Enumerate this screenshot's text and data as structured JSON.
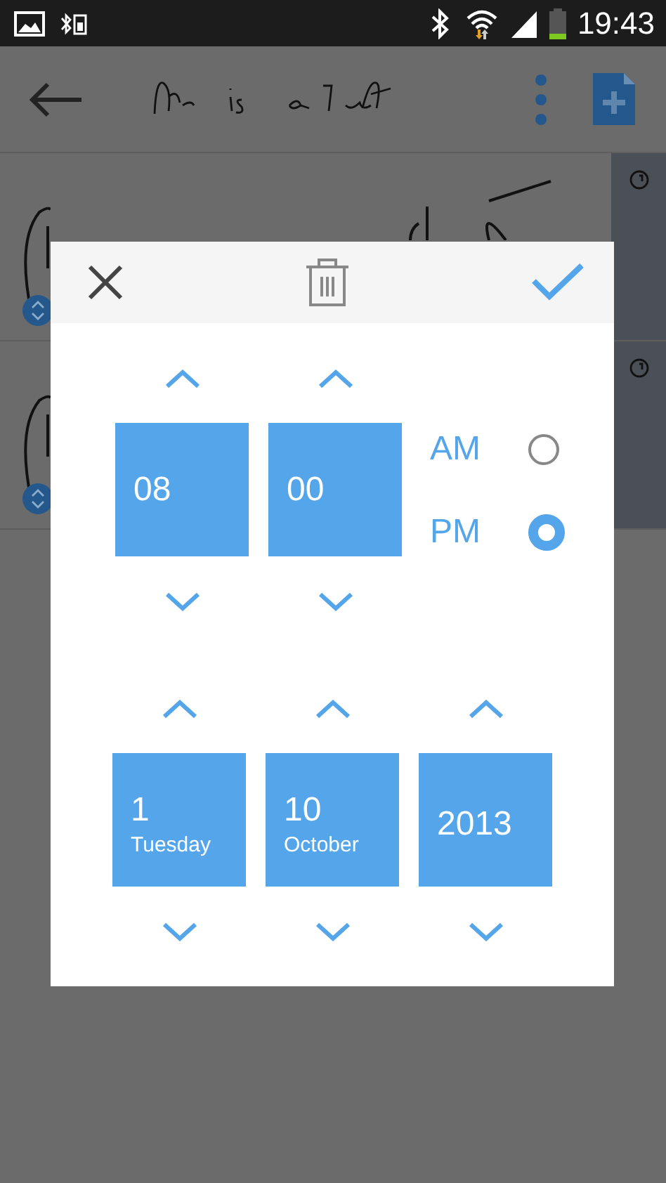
{
  "status_bar": {
    "time": "19:43"
  },
  "dialog": {
    "time": {
      "fields": [
        {
          "value": "08"
        },
        {
          "value": "00"
        }
      ],
      "periods": [
        {
          "label": "AM",
          "selected": false
        },
        {
          "label": "PM",
          "selected": true
        }
      ]
    },
    "date": [
      {
        "value": "1",
        "caption": "Tuesday"
      },
      {
        "value": "10",
        "caption": "October"
      },
      {
        "value": "2013"
      }
    ]
  }
}
